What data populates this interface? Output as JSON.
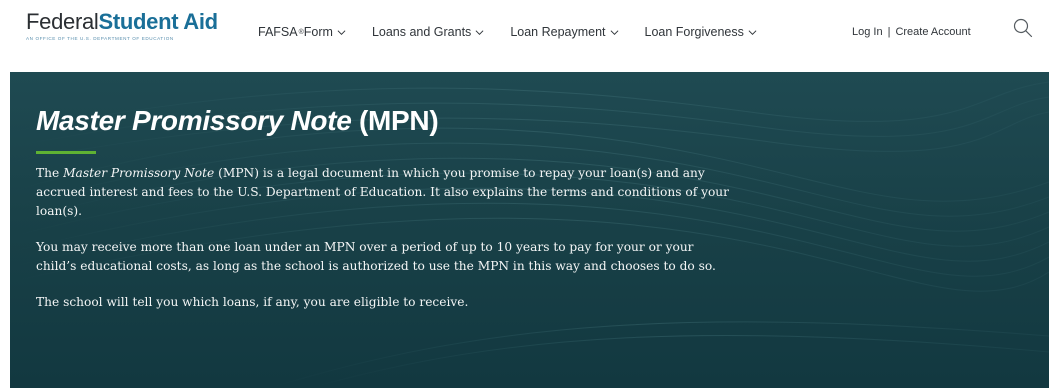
{
  "header": {
    "brand": {
      "name_light": "Federal",
      "name_bold": "Student Aid",
      "tagline": "An OFFICE of the U.S. DEPARTMENT of EDUCATION"
    },
    "nav": {
      "fafsa_label": "FAFSA",
      "fafsa_mark": "®",
      "fafsa_suffix": " Form",
      "loans_grants_label": "Loans and Grants",
      "loan_repayment_label": "Loan Repayment",
      "loan_forgiveness_label": "Loan Forgiveness"
    },
    "account": {
      "login_label": "Log In",
      "separator": "|",
      "create_label": "Create Account"
    },
    "icons": {
      "chevron": "chevron-down-icon",
      "search": "search-icon"
    }
  },
  "hero": {
    "title_italic": "Master Promissory Note",
    "title_rest": " (MPN)",
    "p1_italic": "Master Promissory Note",
    "p1_prefix": "The ",
    "p1_suffix": " (MPN) is a legal document in which you promise to repay your loan(s) and any accrued interest and fees to the U.S. Department of Education. It also explains the terms and conditions of your loan(s).",
    "p2": "You may receive more than one loan under an MPN over a period of up to 10 years to pay for your or your child’s educational costs, as long as the school is authorized to use the MPN in this way and chooses to do so.",
    "p3": "The school will tell you which loans, if any, you are eligible to receive."
  },
  "colors": {
    "brand_blue": "#1a6f98",
    "hero_bg": "#1a434a",
    "accent_green": "#5fb233"
  }
}
